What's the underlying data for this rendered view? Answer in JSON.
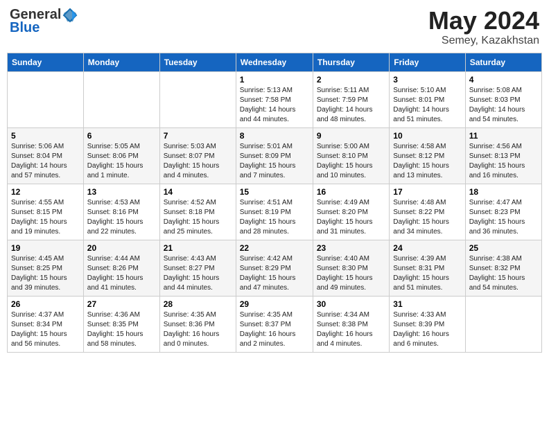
{
  "header": {
    "logo_general": "General",
    "logo_blue": "Blue",
    "month_year": "May 2024",
    "location": "Semey, Kazakhstan"
  },
  "days_of_week": [
    "Sunday",
    "Monday",
    "Tuesday",
    "Wednesday",
    "Thursday",
    "Friday",
    "Saturday"
  ],
  "weeks": [
    [
      {
        "day": "",
        "info": ""
      },
      {
        "day": "",
        "info": ""
      },
      {
        "day": "",
        "info": ""
      },
      {
        "day": "1",
        "info": "Sunrise: 5:13 AM\nSunset: 7:58 PM\nDaylight: 14 hours\nand 44 minutes."
      },
      {
        "day": "2",
        "info": "Sunrise: 5:11 AM\nSunset: 7:59 PM\nDaylight: 14 hours\nand 48 minutes."
      },
      {
        "day": "3",
        "info": "Sunrise: 5:10 AM\nSunset: 8:01 PM\nDaylight: 14 hours\nand 51 minutes."
      },
      {
        "day": "4",
        "info": "Sunrise: 5:08 AM\nSunset: 8:03 PM\nDaylight: 14 hours\nand 54 minutes."
      }
    ],
    [
      {
        "day": "5",
        "info": "Sunrise: 5:06 AM\nSunset: 8:04 PM\nDaylight: 14 hours\nand 57 minutes."
      },
      {
        "day": "6",
        "info": "Sunrise: 5:05 AM\nSunset: 8:06 PM\nDaylight: 15 hours\nand 1 minute."
      },
      {
        "day": "7",
        "info": "Sunrise: 5:03 AM\nSunset: 8:07 PM\nDaylight: 15 hours\nand 4 minutes."
      },
      {
        "day": "8",
        "info": "Sunrise: 5:01 AM\nSunset: 8:09 PM\nDaylight: 15 hours\nand 7 minutes."
      },
      {
        "day": "9",
        "info": "Sunrise: 5:00 AM\nSunset: 8:10 PM\nDaylight: 15 hours\nand 10 minutes."
      },
      {
        "day": "10",
        "info": "Sunrise: 4:58 AM\nSunset: 8:12 PM\nDaylight: 15 hours\nand 13 minutes."
      },
      {
        "day": "11",
        "info": "Sunrise: 4:56 AM\nSunset: 8:13 PM\nDaylight: 15 hours\nand 16 minutes."
      }
    ],
    [
      {
        "day": "12",
        "info": "Sunrise: 4:55 AM\nSunset: 8:15 PM\nDaylight: 15 hours\nand 19 minutes."
      },
      {
        "day": "13",
        "info": "Sunrise: 4:53 AM\nSunset: 8:16 PM\nDaylight: 15 hours\nand 22 minutes."
      },
      {
        "day": "14",
        "info": "Sunrise: 4:52 AM\nSunset: 8:18 PM\nDaylight: 15 hours\nand 25 minutes."
      },
      {
        "day": "15",
        "info": "Sunrise: 4:51 AM\nSunset: 8:19 PM\nDaylight: 15 hours\nand 28 minutes."
      },
      {
        "day": "16",
        "info": "Sunrise: 4:49 AM\nSunset: 8:20 PM\nDaylight: 15 hours\nand 31 minutes."
      },
      {
        "day": "17",
        "info": "Sunrise: 4:48 AM\nSunset: 8:22 PM\nDaylight: 15 hours\nand 34 minutes."
      },
      {
        "day": "18",
        "info": "Sunrise: 4:47 AM\nSunset: 8:23 PM\nDaylight: 15 hours\nand 36 minutes."
      }
    ],
    [
      {
        "day": "19",
        "info": "Sunrise: 4:45 AM\nSunset: 8:25 PM\nDaylight: 15 hours\nand 39 minutes."
      },
      {
        "day": "20",
        "info": "Sunrise: 4:44 AM\nSunset: 8:26 PM\nDaylight: 15 hours\nand 41 minutes."
      },
      {
        "day": "21",
        "info": "Sunrise: 4:43 AM\nSunset: 8:27 PM\nDaylight: 15 hours\nand 44 minutes."
      },
      {
        "day": "22",
        "info": "Sunrise: 4:42 AM\nSunset: 8:29 PM\nDaylight: 15 hours\nand 47 minutes."
      },
      {
        "day": "23",
        "info": "Sunrise: 4:40 AM\nSunset: 8:30 PM\nDaylight: 15 hours\nand 49 minutes."
      },
      {
        "day": "24",
        "info": "Sunrise: 4:39 AM\nSunset: 8:31 PM\nDaylight: 15 hours\nand 51 minutes."
      },
      {
        "day": "25",
        "info": "Sunrise: 4:38 AM\nSunset: 8:32 PM\nDaylight: 15 hours\nand 54 minutes."
      }
    ],
    [
      {
        "day": "26",
        "info": "Sunrise: 4:37 AM\nSunset: 8:34 PM\nDaylight: 15 hours\nand 56 minutes."
      },
      {
        "day": "27",
        "info": "Sunrise: 4:36 AM\nSunset: 8:35 PM\nDaylight: 15 hours\nand 58 minutes."
      },
      {
        "day": "28",
        "info": "Sunrise: 4:35 AM\nSunset: 8:36 PM\nDaylight: 16 hours\nand 0 minutes."
      },
      {
        "day": "29",
        "info": "Sunrise: 4:35 AM\nSunset: 8:37 PM\nDaylight: 16 hours\nand 2 minutes."
      },
      {
        "day": "30",
        "info": "Sunrise: 4:34 AM\nSunset: 8:38 PM\nDaylight: 16 hours\nand 4 minutes."
      },
      {
        "day": "31",
        "info": "Sunrise: 4:33 AM\nSunset: 8:39 PM\nDaylight: 16 hours\nand 6 minutes."
      },
      {
        "day": "",
        "info": ""
      }
    ]
  ]
}
